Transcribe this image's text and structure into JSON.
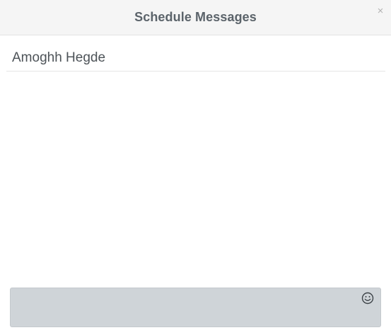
{
  "dialog": {
    "title": "Schedule Messages",
    "close_label": "×"
  },
  "recipient": {
    "name": "Amoghh Hegde"
  },
  "composer": {
    "value": "",
    "placeholder": ""
  },
  "icons": {
    "close": "close-icon",
    "emoji": "smiley-icon"
  }
}
